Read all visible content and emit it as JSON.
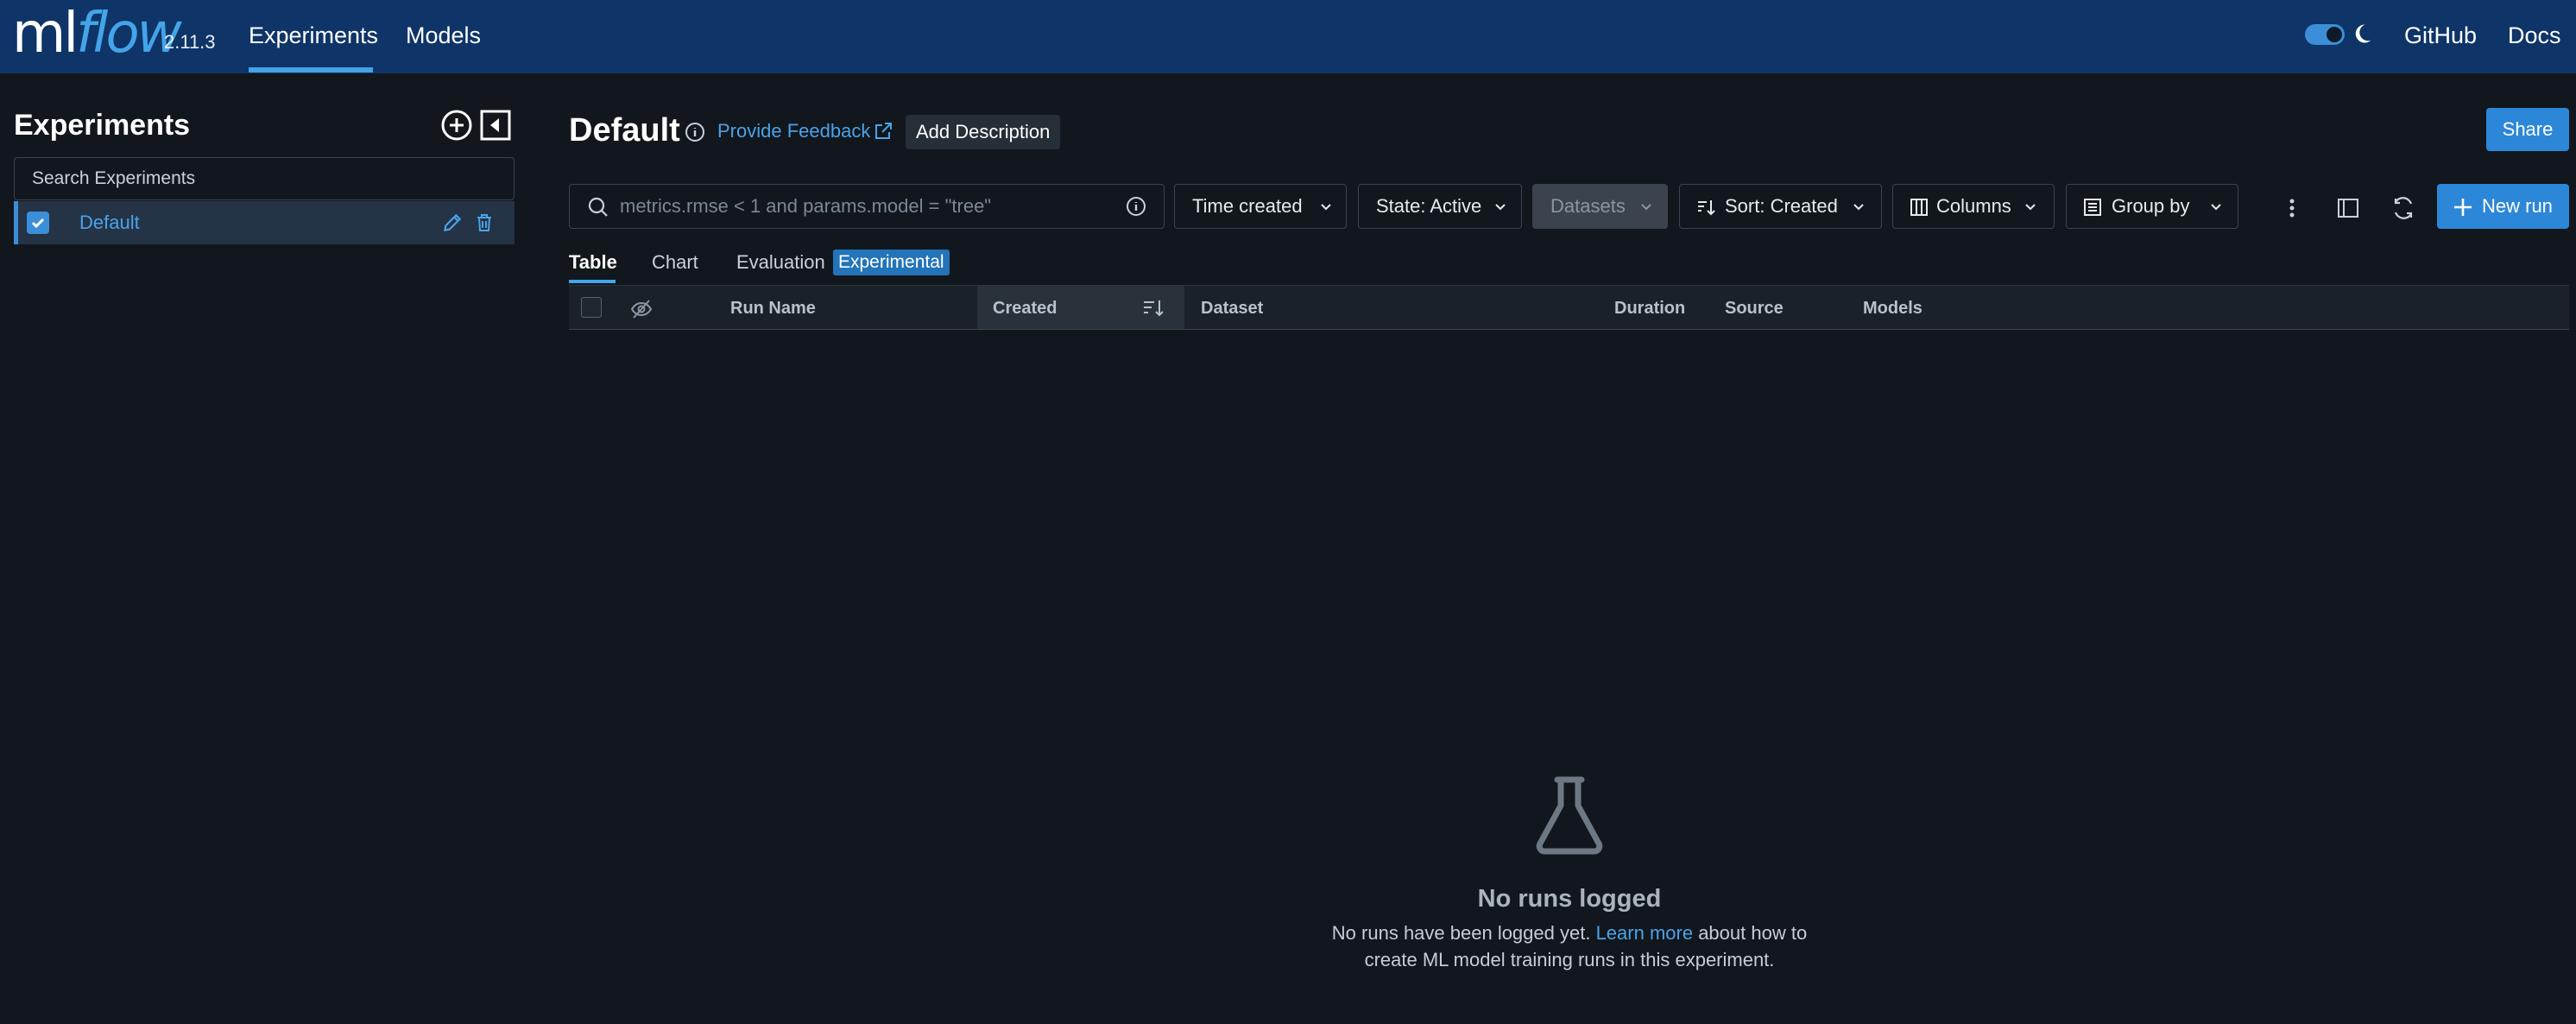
{
  "nav": {
    "logo_ml": "ml",
    "logo_flow": "flow",
    "version": "2.11.3",
    "experiments": "Experiments",
    "models": "Models",
    "github": "GitHub",
    "docs": "Docs",
    "accent_color": "#43a4e8",
    "bg_color": "#0e3468"
  },
  "sidebar": {
    "title": "Experiments",
    "search_placeholder": "Search Experiments",
    "items": [
      {
        "label": "Default",
        "checked": true
      }
    ]
  },
  "header": {
    "title": "Default",
    "feedback": "Provide Feedback",
    "add_description": "Add Description",
    "share": "Share"
  },
  "toolbar": {
    "search_placeholder": "metrics.rmse < 1 and params.model = \"tree\"",
    "time_created": "Time created",
    "state": "State: Active",
    "datasets": "Datasets",
    "sort": "Sort: Created",
    "columns": "Columns",
    "group_by": "Group by",
    "new_run": "New run"
  },
  "tabs": {
    "table": "Table",
    "chart": "Chart",
    "evaluation": "Evaluation",
    "experimental_badge": "Experimental"
  },
  "table": {
    "columns": [
      "Run Name",
      "Created",
      "Dataset",
      "Duration",
      "Source",
      "Models"
    ]
  },
  "empty_state": {
    "title": "No runs logged",
    "line1_prefix": "No runs have been logged yet. ",
    "link": "Learn more",
    "line1_suffix": " about how to",
    "line2": "create ML model training runs in this experiment."
  }
}
